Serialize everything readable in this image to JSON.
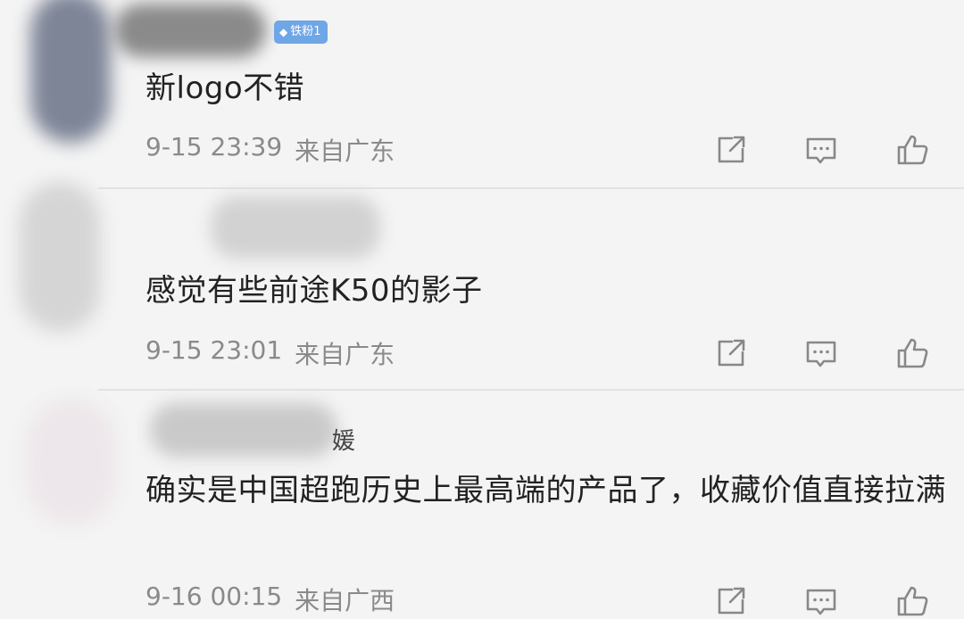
{
  "comments": [
    {
      "badge": "铁粉1",
      "text": "新logo不错",
      "date": "9-15 23:39",
      "location": "来自广东"
    },
    {
      "text": "感觉有些前途K50的影子",
      "date": "9-15 23:01",
      "location": "来自广东"
    },
    {
      "name_tail": "媛",
      "text": "确实是中国超跑历史上最高端的产品了，收藏价值直接拉满",
      "date": "9-16 00:15",
      "location": "来自广西"
    }
  ],
  "icons": {
    "share": "share-icon",
    "comment": "comment-icon",
    "like": "thumbs-up-icon"
  },
  "colors": {
    "badge": "#6fa6e6",
    "meta_text": "#8a8a8a",
    "background": "#f4f4f4"
  }
}
